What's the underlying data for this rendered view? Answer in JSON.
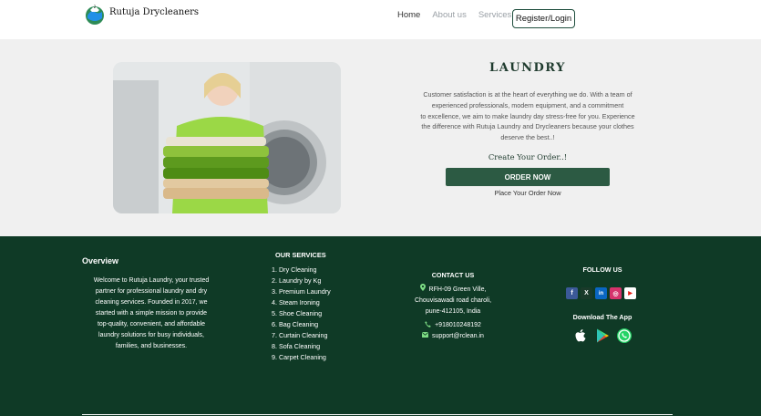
{
  "brand": {
    "name": "Rutuja Drycleaners"
  },
  "nav": {
    "items": [
      {
        "label": "Home",
        "active": true
      },
      {
        "label": "About us",
        "active": false
      },
      {
        "label": "Services",
        "active": false
      }
    ],
    "register_label": "Register/Login"
  },
  "hero": {
    "title": "LAUNDRY",
    "text_lines": [
      "Customer satisfaction is at the heart of everything we do. With a team of",
      "experienced professionals, modern equipment, and a commitment",
      "to excellence, we aim to make laundry day stress-free for you. Experience",
      "the difference with Rutuja Laundry and Drycleaners because your clothes",
      "deserve the best..!"
    ],
    "create_order": "Create Your Order..!",
    "order_button": "ORDER NOW",
    "place_order": "Place Your Order Now"
  },
  "footer": {
    "overview": {
      "title": "Overview",
      "lines": [
        "Welcome to Rutuja Laundry, your trusted",
        "partner for professional laundry and dry",
        "cleaning services. Founded in 2017, we",
        "started with a simple mission to provide",
        "top-quality, convenient, and affordable",
        "laundry solutions for busy individuals,",
        "families, and businesses."
      ]
    },
    "services": {
      "title": "OUR SERVICES",
      "items": [
        "1. Dry Cleaning",
        "2. Laundry by Kg",
        "3. Premium Laundry",
        "4. Steam Ironing",
        "5. Shoe Cleaning",
        "6. Bag Cleaning",
        "7. Curtain Cleaning",
        "8. Sofa Cleaning",
        "9. Carpet Cleaning"
      ]
    },
    "contact": {
      "title": "CONTACT US",
      "address_lines": [
        "RFH-09 Green Ville,",
        "Chouvisawadi road charoli,",
        "pune-412105, India"
      ],
      "phone": "+918010248192",
      "email": "support@rclean.in"
    },
    "follow": {
      "title": "FOLLOW US",
      "socials": [
        {
          "icon": "facebook-icon",
          "glyph": "f",
          "color": "#3b5998"
        },
        {
          "icon": "x-icon",
          "glyph": "X",
          "color": "#1a3a2a"
        },
        {
          "icon": "linkedin-icon",
          "glyph": "in",
          "color": "#0a66c2"
        },
        {
          "icon": "instagram-icon",
          "glyph": "◎",
          "color": "#d6336c"
        },
        {
          "icon": "youtube-icon",
          "glyph": "▶",
          "color": "#ffffff"
        }
      ]
    },
    "download": {
      "title": "Download The App",
      "apps": [
        "apple-icon",
        "google-play-icon",
        "whatsapp-icon"
      ]
    }
  },
  "colors": {
    "brand_green": "#0f3a26",
    "button_green": "#2c5a43",
    "hero_bg": "#f0f0f0"
  }
}
